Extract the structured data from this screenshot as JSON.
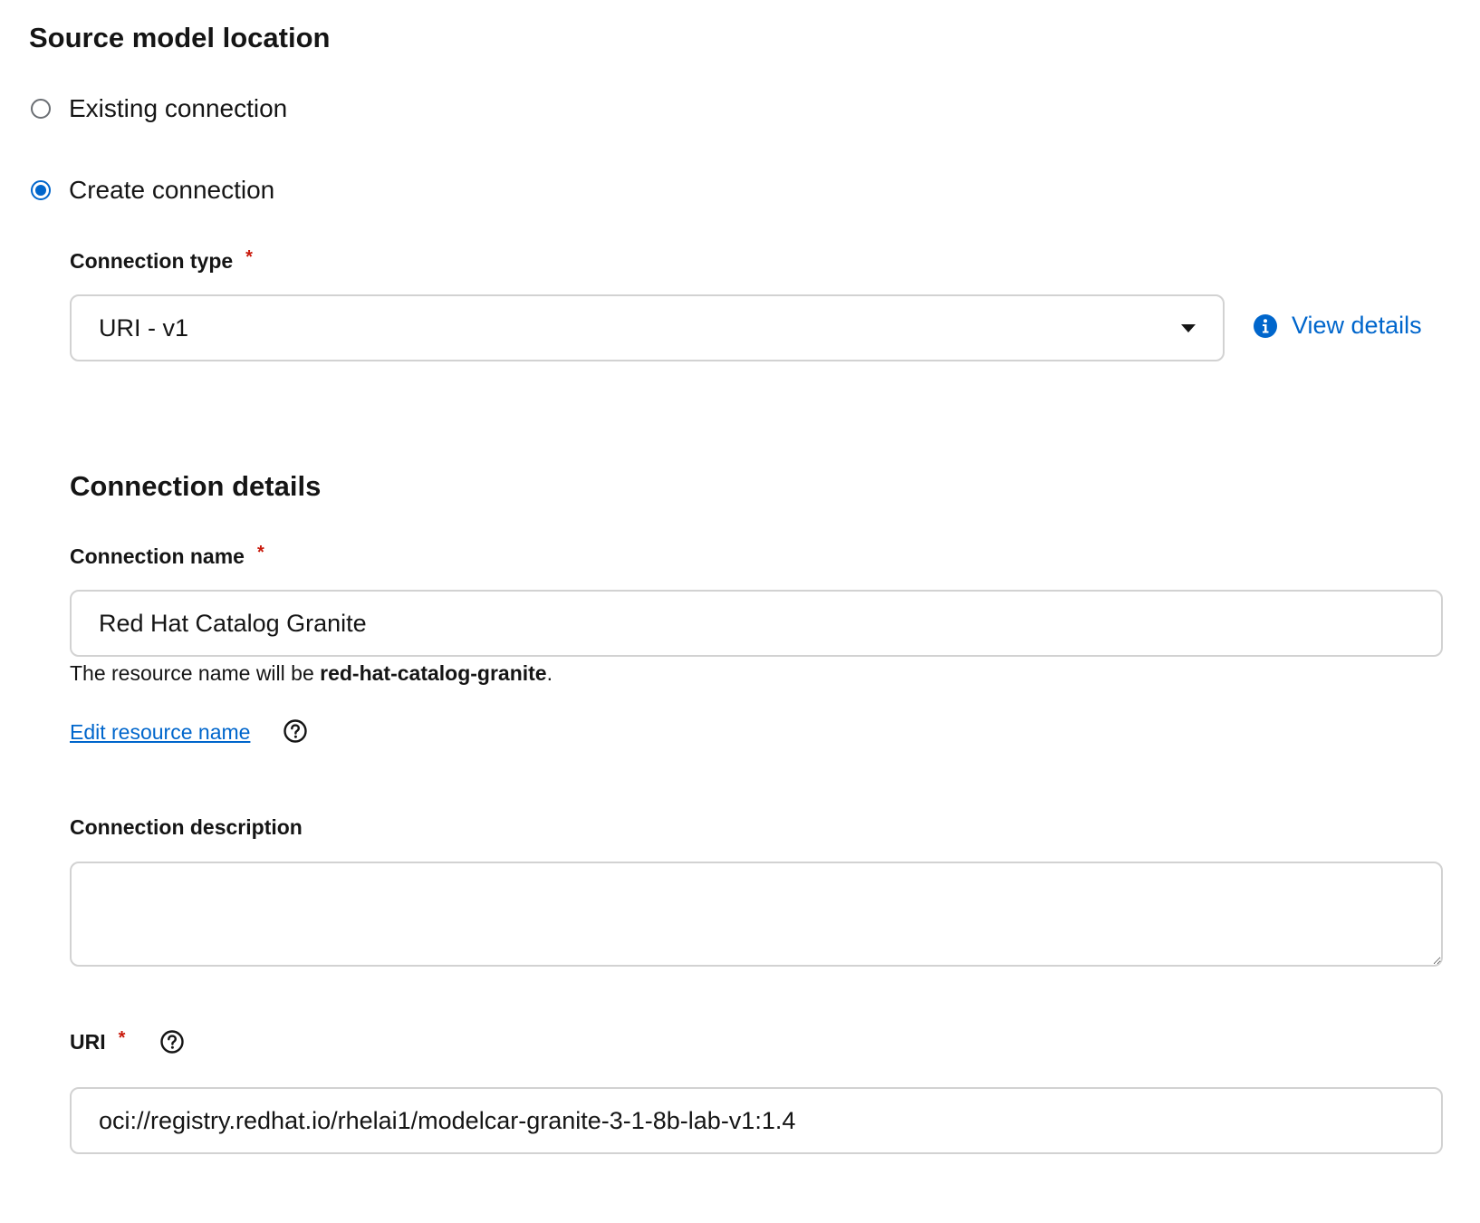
{
  "section": {
    "title": "Source model location"
  },
  "radios": {
    "existing": {
      "label": "Existing connection",
      "checked": false
    },
    "create": {
      "label": "Create connection",
      "checked": true
    }
  },
  "connection_type": {
    "label": "Connection type",
    "required_mark": "*",
    "selected": "URI - v1",
    "view_details": "View details"
  },
  "connection_details": {
    "title": "Connection details",
    "name_label": "Connection name",
    "name_required": "*",
    "name_value": "Red Hat Catalog Granite",
    "helper_prefix": "The resource name will be ",
    "resource_name": "red-hat-catalog-granite",
    "helper_suffix": ".",
    "edit_link": "Edit resource name",
    "description_label": "Connection description",
    "description_value": "",
    "uri_label": "URI",
    "uri_required": "*",
    "uri_value": "oci://registry.redhat.io/rhelai1/modelcar-granite-3-1-8b-lab-v1:1.4"
  },
  "colors": {
    "accent": "#0066cc",
    "required": "#c9190b",
    "border": "#d2d2d2"
  },
  "icons": {
    "info": "info-circle-icon",
    "help": "question-circle-icon",
    "caret": "caret-down-icon"
  }
}
